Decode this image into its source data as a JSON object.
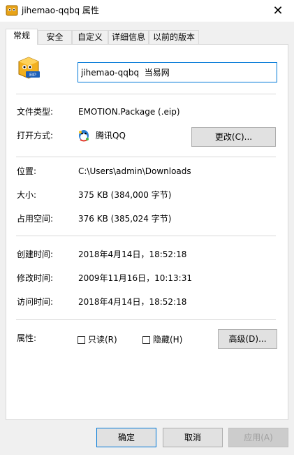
{
  "window": {
    "title": "jihemao-qqbq 属性",
    "close_glyph": "✕"
  },
  "tabs": [
    {
      "label": "常规",
      "active": true
    },
    {
      "label": "安全",
      "active": false
    },
    {
      "label": "自定义",
      "active": false
    },
    {
      "label": "详细信息",
      "active": false
    },
    {
      "label": "以前的版本",
      "active": false
    }
  ],
  "file": {
    "name": "jihemao-qqbq  当易网",
    "icon": "eip-file-icon",
    "icon_badge": "EIP"
  },
  "fields": {
    "type_label": "文件类型:",
    "type_value": "EMOTION.Package (.eip)",
    "open_label": "打开方式:",
    "open_value": "腾讯QQ",
    "open_icon": "qq-icon",
    "change_button": "更改(C)...",
    "location_label": "位置:",
    "location_value": "C:\\Users\\admin\\Downloads",
    "size_label": "大小:",
    "size_value": "375 KB (384,000 字节)",
    "disk_label": "占用空间:",
    "disk_value": "376 KB (385,024 字节)",
    "created_label": "创建时间:",
    "created_value": "2018年4月14日，18:52:18",
    "modified_label": "修改时间:",
    "modified_value": "2009年11月16日，10:13:31",
    "accessed_label": "访问时间:",
    "accessed_value": "2018年4月14日，18:52:18",
    "attr_label": "属性:",
    "readonly_label": "只读(R)",
    "readonly_checked": false,
    "hidden_label": "隐藏(H)",
    "hidden_checked": false,
    "advanced_button": "高级(D)..."
  },
  "footer": {
    "ok": "确定",
    "cancel": "取消",
    "apply": "应用(A)"
  },
  "colors": {
    "accent": "#0078d7",
    "panel_bg": "#ffffff",
    "window_bg": "#f0f0f0"
  }
}
